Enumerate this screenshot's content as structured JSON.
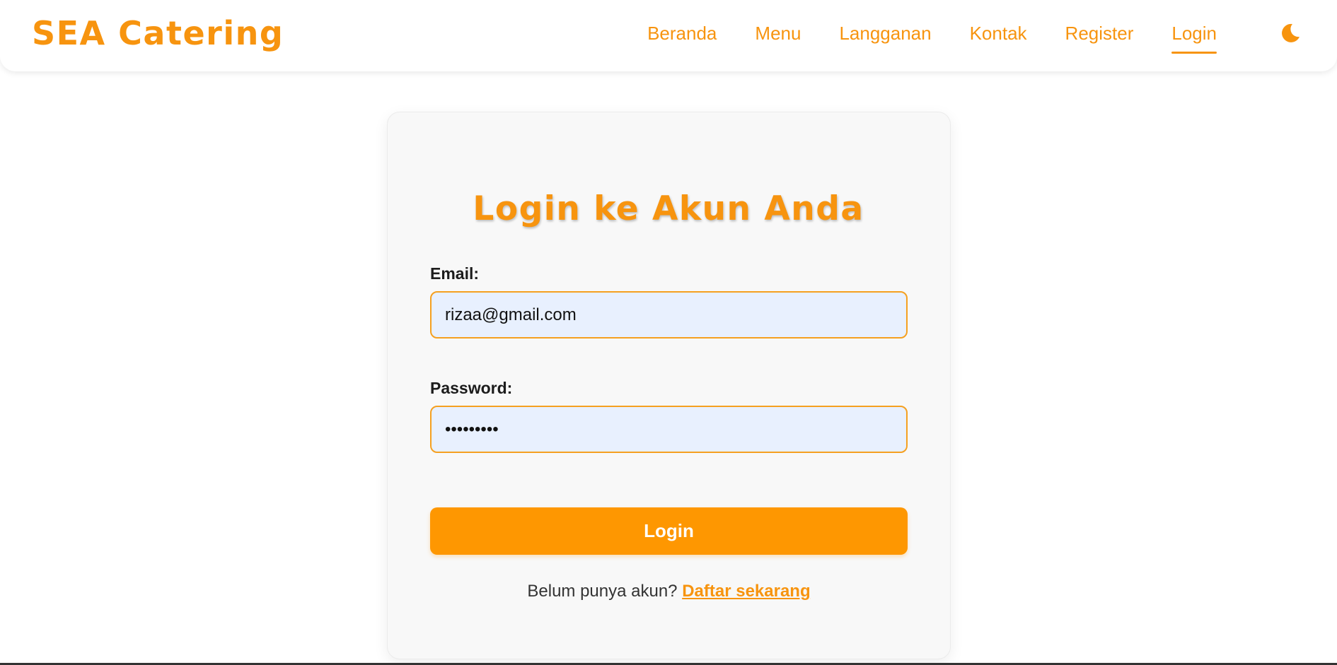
{
  "navbar": {
    "brand": "SEA Catering",
    "links": [
      {
        "label": "Beranda"
      },
      {
        "label": "Menu"
      },
      {
        "label": "Langganan"
      },
      {
        "label": "Kontak"
      },
      {
        "label": "Register"
      },
      {
        "label": "Login",
        "active": true
      }
    ],
    "theme_toggle_icon": "moon-icon"
  },
  "login_card": {
    "title": "Login ke Akun Anda",
    "email_label": "Email:",
    "email_value": "rizaa@gmail.com",
    "password_label": "Password:",
    "password_value": "rizaa1234",
    "submit_label": "Login",
    "register_prompt": "Belum punya akun?",
    "register_link": "Daftar sekarang"
  },
  "colors": {
    "accent": "#f7940f",
    "button": "#fe9701",
    "input_bg": "#e8f0fe",
    "card_bg": "#f8f8f8"
  }
}
